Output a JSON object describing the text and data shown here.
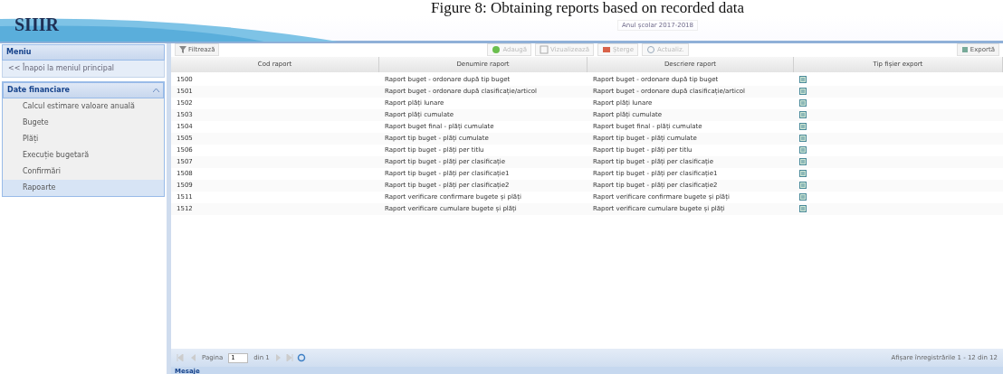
{
  "caption": "Figure 8: Obtaining reports based on recorded data",
  "header": {
    "logo": "SIIIR",
    "year_select": "Anul școlar 2017-2018"
  },
  "sidebar": {
    "title": "Meniu",
    "back_link": "<< Înapoi la meniul principal",
    "section": "Date financiare",
    "expanded": true,
    "items": [
      {
        "label": "Calcul estimare valoare anuală",
        "selected": false
      },
      {
        "label": "Bugete",
        "selected": false
      },
      {
        "label": "Plăți",
        "selected": false
      },
      {
        "label": "Execuție bugetară",
        "selected": false
      },
      {
        "label": "Confirmări",
        "selected": false
      },
      {
        "label": "Rapoarte",
        "selected": true
      }
    ]
  },
  "toolbar": {
    "filter": "Filtrează",
    "actions": [
      {
        "label": "Adaugă",
        "kind": "add",
        "disabled": true
      },
      {
        "label": "Vizualizează",
        "kind": "view",
        "disabled": true
      },
      {
        "label": "Șterge",
        "kind": "delete",
        "disabled": true
      },
      {
        "label": "Actualiz.",
        "kind": "refresh",
        "disabled": true
      }
    ],
    "export": "Exportă"
  },
  "table": {
    "columns": [
      "Cod raport",
      "Denumire raport",
      "Descriere raport",
      "Tip fișier export"
    ],
    "rows": [
      {
        "code": "1500",
        "name": "Raport buget - ordonare după tip buget",
        "description": "Raport buget - ordonare după tip buget"
      },
      {
        "code": "1501",
        "name": "Raport buget - ordonare după clasificație/articol",
        "description": "Raport buget - ordonare după clasificație/articol"
      },
      {
        "code": "1502",
        "name": "Raport plăți lunare",
        "description": "Raport plăți lunare"
      },
      {
        "code": "1503",
        "name": "Raport plăți cumulate",
        "description": "Raport plăți cumulate"
      },
      {
        "code": "1504",
        "name": "Raport buget final - plăți cumulate",
        "description": "Raport buget final - plăți cumulate"
      },
      {
        "code": "1505",
        "name": "Raport tip buget - plăți cumulate",
        "description": "Raport tip buget - plăți cumulate"
      },
      {
        "code": "1506",
        "name": "Raport tip buget - plăți per titlu",
        "description": "Raport tip buget - plăți per titlu"
      },
      {
        "code": "1507",
        "name": "Raport tip buget - plăți per clasificație",
        "description": "Raport tip buget - plăți per clasificație"
      },
      {
        "code": "1508",
        "name": "Raport tip buget - plăți per clasificație1",
        "description": "Raport tip buget - plăți per clasificație1"
      },
      {
        "code": "1509",
        "name": "Raport tip buget - plăți per clasificație2",
        "description": "Raport tip buget - plăți per clasificație2"
      },
      {
        "code": "1511",
        "name": "Raport verificare confirmare bugete și plăți",
        "description": "Raport verificare confirmare bugete și plăți"
      },
      {
        "code": "1512",
        "name": "Raport verificare cumulare bugete și plăți",
        "description": "Raport verificare cumulare bugete și plăți"
      }
    ]
  },
  "pager": {
    "page_label": "Pagina",
    "page": "1",
    "of": "din 1",
    "summary": "Afișare înregistrările 1 - 12 din 12"
  },
  "messages_panel": {
    "title": "Mesaje"
  }
}
